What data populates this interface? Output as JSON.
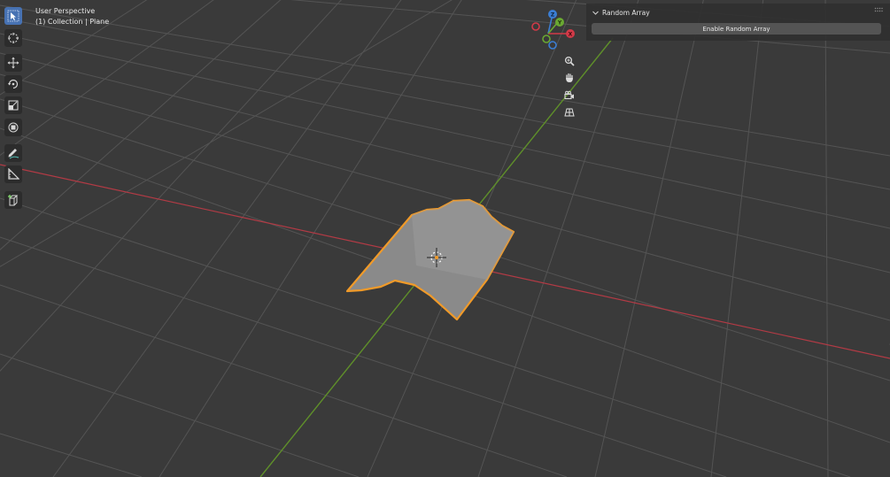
{
  "viewport": {
    "view_name": "User Perspective",
    "collection_label": "(1) Collection | Plane"
  },
  "gizmo": {
    "z_label": "Z",
    "y_label": "Y",
    "x_label": "X"
  },
  "panel": {
    "title": "Random Array",
    "button_label": "Enable Random Array"
  },
  "toolbar": {
    "tools": [
      "select-box",
      "cursor",
      "move",
      "rotate",
      "scale",
      "transform",
      "annotate",
      "measure",
      "add-cube"
    ],
    "active_tool": "select-box"
  },
  "nav_buttons": [
    "zoom",
    "pan",
    "camera-view",
    "toggle-perspective"
  ],
  "colors": {
    "background": "#3a3a3a",
    "grid": "#545454",
    "x_axis": "#b23a45",
    "y_axis": "#5f8f2a",
    "selection_outline": "#f09a29",
    "active_tool": "#4772b3"
  }
}
